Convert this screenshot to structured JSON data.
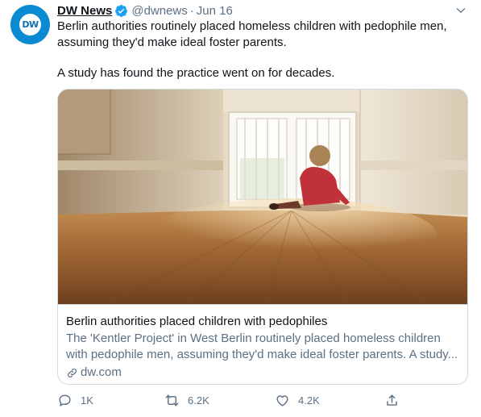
{
  "tweet": {
    "avatar": {
      "text": "DW",
      "bg": "#0a8bd1"
    },
    "author_name": "DW News",
    "author_handle": "@dwnews",
    "separator": "·",
    "date": "Jun 16",
    "text_paragraphs": [
      "Berlin authorities routinely placed homeless children with pedophile men, assuming they'd make ideal foster parents.",
      "A study has found the practice went on for decades."
    ],
    "card": {
      "title": "Berlin authorities placed children with pedophiles",
      "description": "The 'Kentler Project' in West Berlin routinely placed homeless children with pedophile men, assuming they'd make ideal foster parents. A study...",
      "domain": "dw.com"
    },
    "actions": {
      "reply_count": "1K",
      "retweet_count": "6.2K",
      "like_count": "4.2K"
    }
  },
  "icons": [
    "verified-badge-icon",
    "chevron-down-icon",
    "link-icon",
    "reply-icon",
    "retweet-icon",
    "like-icon",
    "share-icon"
  ],
  "colors": {
    "accent": "#1da1f2",
    "secondary_text": "#5b7083",
    "border": "#cfd9de"
  }
}
